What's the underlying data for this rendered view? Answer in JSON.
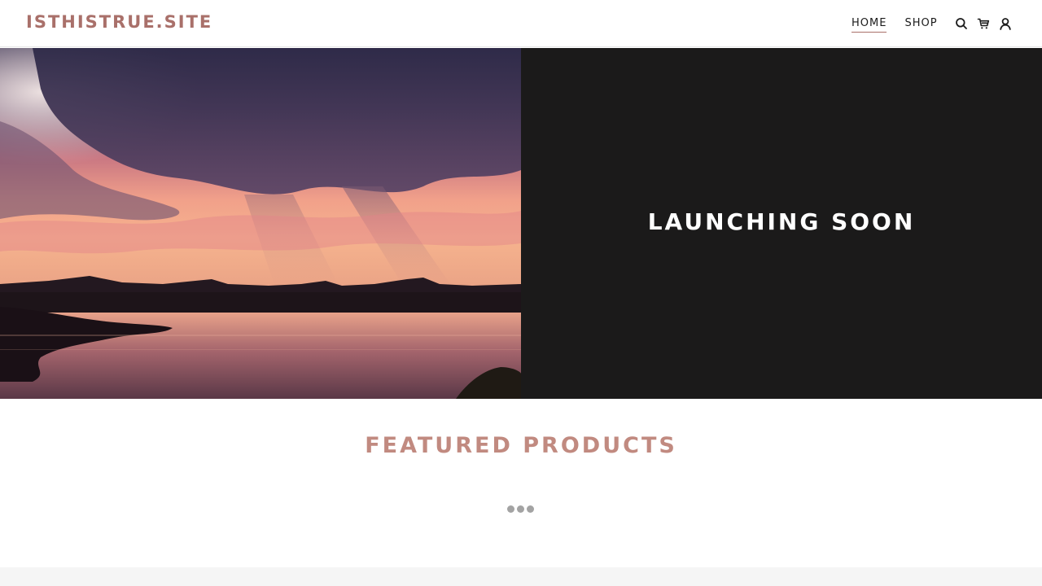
{
  "header": {
    "logo": "ISTHISTRUE.SITE",
    "nav": [
      {
        "label": "HOME",
        "active": true
      },
      {
        "label": "SHOP",
        "active": false
      }
    ],
    "icons": [
      "search-icon",
      "cart-icon",
      "account-icon"
    ]
  },
  "hero": {
    "title": "LAUNCHING SOON"
  },
  "featured": {
    "title": "FEATURED PRODUCTS"
  },
  "colors": {
    "accent": "#a9706a",
    "featured_title": "#c18a80",
    "hero_panel": "#1b1a1a",
    "loader_dot": "#a3a3a3"
  }
}
